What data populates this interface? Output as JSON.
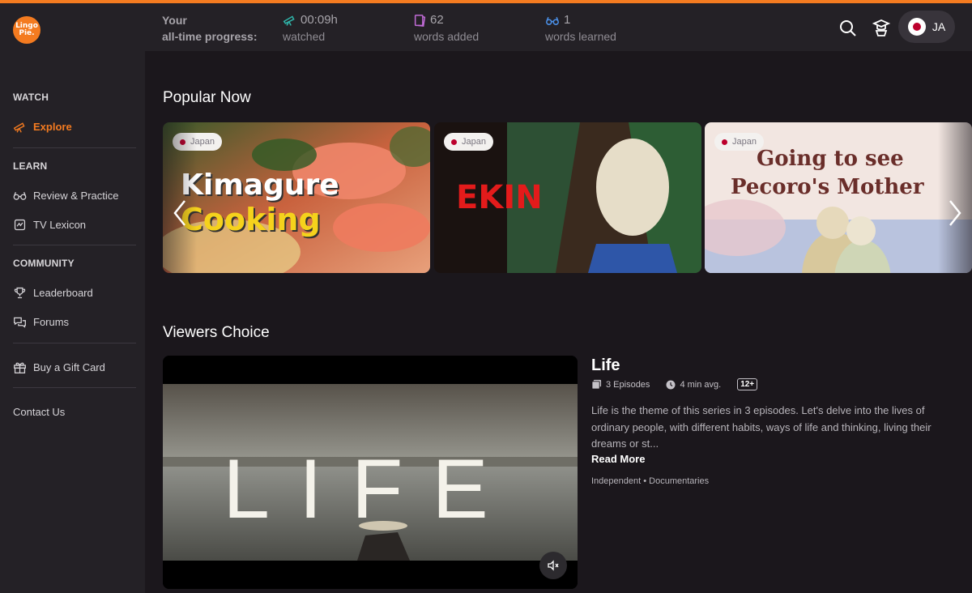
{
  "brand": {
    "logo_line1": "Lingo",
    "logo_line2": "Pie.",
    "accent": "#f47b20"
  },
  "sidebar": {
    "watch_section": "WATCH",
    "learn_section": "LEARN",
    "community_section": "COMMUNITY",
    "items": {
      "explore": "Explore",
      "review": "Review & Practice",
      "lexicon": "TV Lexicon",
      "leaderboard": "Leaderboard",
      "forums": "Forums",
      "gift": "Buy a Gift Card"
    },
    "contact": "Contact Us"
  },
  "header": {
    "progress_line1": "Your",
    "progress_line2": "all-time progress:",
    "stats": [
      {
        "value": "00:09h",
        "label": "watched",
        "icon": "telescope-icon",
        "color": "#2fb3a8"
      },
      {
        "value": "62",
        "label": "words added",
        "icon": "card-icon",
        "color": "#c06bd6"
      },
      {
        "value": "1",
        "label": "words learned",
        "icon": "glasses-icon",
        "color": "#4a8fe6"
      }
    ],
    "language": "JA"
  },
  "popular": {
    "title": "Popular Now",
    "cards": [
      {
        "badge": "Japan",
        "title_line1": "Kimagure",
        "title_line2": "Cooking"
      },
      {
        "badge": "Japan",
        "title_line1": "EKIN"
      },
      {
        "badge": "Japan",
        "title_line1": "Going to see",
        "title_line2": "Pecoro's Mother"
      }
    ]
  },
  "viewers_choice": {
    "title": "Viewers Choice",
    "video_text": "LIFE",
    "show": {
      "title": "Life",
      "episodes": "3 Episodes",
      "duration": "4 min avg.",
      "age": "12+",
      "description": "Life is the theme of this series in 3 episodes. Let's delve into the lives of ordinary people, with different habits, ways of life and thinking, living their dreams or st...",
      "read_more": "Read More",
      "genres": "Independent • Documentaries"
    }
  }
}
